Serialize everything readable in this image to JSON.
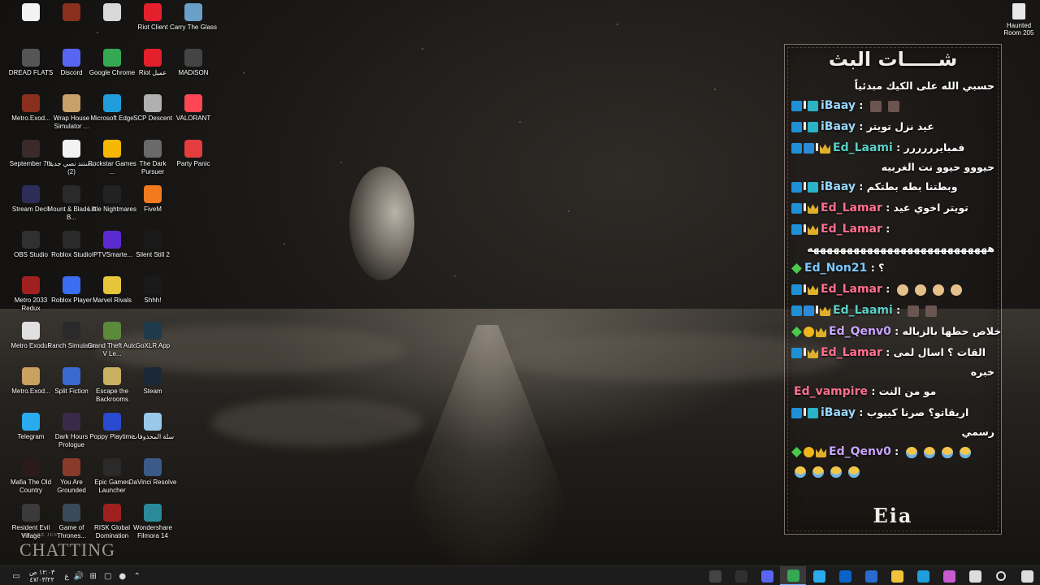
{
  "desktop": {
    "icons": [
      {
        "label": "",
        "color": "#f2f2f2"
      },
      {
        "label": "",
        "color": "#8a2f1e"
      },
      {
        "label": "",
        "color": "#d8d8d8"
      },
      {
        "label": "Riot Client",
        "color": "#e3202b"
      },
      {
        "label": "Carry The Glass",
        "color": "#6aa0c8"
      },
      {
        "label": "DREAD FLATS",
        "color": "#555555"
      },
      {
        "label": "Discord",
        "color": "#5865f2"
      },
      {
        "label": "Google Chrome",
        "color": "#34a853"
      },
      {
        "label": "Riot عميل",
        "color": "#e3202b"
      },
      {
        "label": "MADiSON",
        "color": "#444444"
      },
      {
        "label": "Metro.Exod...",
        "color": "#8a2f1e"
      },
      {
        "label": "Wrap House Simulator ...",
        "color": "#c9a06a"
      },
      {
        "label": "Microsoft Edge",
        "color": "#1f9edb"
      },
      {
        "label": "SCP Descent",
        "color": "#b0b0b0"
      },
      {
        "label": "VALORANT",
        "color": "#ff4655"
      },
      {
        "label": "September 7th",
        "color": "#3a2a2a"
      },
      {
        "label": "مستند نصي جديد (2)",
        "color": "#f2f2f2"
      },
      {
        "label": "Rockstar Games ...",
        "color": "#f5b800"
      },
      {
        "label": "The Dark Pursuer",
        "color": "#6a6a6a"
      },
      {
        "label": "Party Panic",
        "color": "#e33d3d"
      },
      {
        "label": "Stream Deck",
        "color": "#2d2d5a"
      },
      {
        "label": "Mount & Blade II B...",
        "color": "#2a2a2a"
      },
      {
        "label": "Little Nightmares",
        "color": "#222222"
      },
      {
        "label": "FiveM",
        "color": "#f47a20"
      },
      {
        "label": "",
        "color": "#000000"
      },
      {
        "label": "OBS Studio",
        "color": "#303030"
      },
      {
        "label": "Roblox Studio",
        "color": "#2a2a2a"
      },
      {
        "label": "IPTVSmarte...",
        "color": "#5a2ad0"
      },
      {
        "label": "Silent Still 2",
        "color": "#1a1a1a"
      },
      {
        "label": "",
        "color": "#000000"
      },
      {
        "label": "Metro 2033 Redux",
        "color": "#a02020"
      },
      {
        "label": "Roblox Player",
        "color": "#3a6df0"
      },
      {
        "label": "Marvel Rivals",
        "color": "#e6c53a"
      },
      {
        "label": "Shhh!",
        "color": "#1a1a1a"
      },
      {
        "label": "",
        "color": "#000000"
      },
      {
        "label": "Metro Exodus",
        "color": "#e0e0e0"
      },
      {
        "label": "Ranch Simulator",
        "color": "#2a2a2a"
      },
      {
        "label": "Grand Theft Auto V Le...",
        "color": "#5a8a3a"
      },
      {
        "label": "GoXLR App",
        "color": "#1f3a4a"
      },
      {
        "label": "",
        "color": "#000000"
      },
      {
        "label": "Metro.Exod...",
        "color": "#c8a060"
      },
      {
        "label": "Split Fiction",
        "color": "#3a6ad0"
      },
      {
        "label": "Escape the Backrooms",
        "color": "#c8b060"
      },
      {
        "label": "Steam",
        "color": "#1b2838"
      },
      {
        "label": "",
        "color": "#000000"
      },
      {
        "label": "Telegram",
        "color": "#2aabee"
      },
      {
        "label": "Dark Hours Prologue",
        "color": "#3a2a4a"
      },
      {
        "label": "Poppy Playtime",
        "color": "#2a4ad0"
      },
      {
        "label": "سلة المحذوفات",
        "color": "#9ac8e8"
      },
      {
        "label": "",
        "color": "#000000"
      },
      {
        "label": "Mafia The Old Country",
        "color": "#2a1a1a"
      },
      {
        "label": "You Are Grounded",
        "color": "#8a3a2a"
      },
      {
        "label": "Epic Games Launcher",
        "color": "#2a2a2a"
      },
      {
        "label": "DaVinci Resolve",
        "color": "#3a5a8a"
      },
      {
        "label": "",
        "color": "#000000"
      },
      {
        "label": "Resident Evil Village",
        "color": "#3a3a3a"
      },
      {
        "label": "Game of Thrones...",
        "color": "#3a4a5a"
      },
      {
        "label": "RISK Global Domination",
        "color": "#a02020"
      },
      {
        "label": "Wondershare Filmora 14",
        "color": "#2a8a9a"
      }
    ],
    "corner_icon_label": "Haunted Room 205"
  },
  "overlay": {
    "logo_text": "CHATTING",
    "logo_small": "WE ARE JUST"
  },
  "chat": {
    "title": "شـــــات البث",
    "pinned": "حسبي الله على الكيك مبدئياً",
    "messages": [
      {
        "user": "iBaay",
        "text": "",
        "badges": [
          "arrow",
          "sep",
          "cyan"
        ],
        "emoji": "pic",
        "user_class": "u-ibaay"
      },
      {
        "user": "iBaay",
        "text": "عيد نزل تويتر",
        "badges": [
          "arrow",
          "sep",
          "cyan"
        ],
        "user_class": "u-ibaay"
      },
      {
        "user": "Ed_Laami",
        "text": "فمبايرررررر",
        "badges": [
          "arrow",
          "cube",
          "sep",
          "crown"
        ],
        "user_class": "u-laami",
        "cont": "حيووو حيوو نت الغربيه"
      },
      {
        "user": "iBaay",
        "text": "وبطتنا بطه بطتكم",
        "badges": [
          "arrow",
          "sep",
          "cyan"
        ],
        "user_class": "u-ibaay"
      },
      {
        "user": "Ed_Lamar",
        "text": "تويتر اخوي عيد",
        "badges": [
          "arrow",
          "sep",
          "crown"
        ],
        "user_class": "u-lamar"
      },
      {
        "user": "Ed_Lamar",
        "text": "",
        "badges": [
          "arrow",
          "sep",
          "crown"
        ],
        "user_class": "u-lamar",
        "cont": "هههههههههههههههههههههههههههه"
      },
      {
        "user": "Ed_Non21",
        "text": "؟",
        "badges": [
          "gem"
        ],
        "user_class": "u-non"
      },
      {
        "user": "Ed_Lamar",
        "text": "",
        "badges": [
          "arrow",
          "sep",
          "crown"
        ],
        "user_class": "u-lamar",
        "emoji": "bread"
      },
      {
        "user": "Ed_Laami",
        "text": "",
        "badges": [
          "arrow",
          "cube",
          "sep",
          "crown"
        ],
        "user_class": "u-laami",
        "emoji": "pic"
      },
      {
        "user": "Ed_Qenv0",
        "text": "خلاص حطها بالزباله",
        "badges": [
          "gem",
          "one",
          "crown"
        ],
        "user_class": "u-qenv"
      },
      {
        "user": "Ed_Lamar",
        "text": "القات ؟ اسال لمى",
        "badges": [
          "arrow",
          "sep",
          "crown"
        ],
        "user_class": "u-lamar",
        "cont": "خبره"
      },
      {
        "user": "Ed_vampire",
        "text": "مو من النت",
        "badges": [],
        "user_class": "u-vamp"
      },
      {
        "user": "iBaay",
        "text": "اريقاتو؟ صرنا كيبوب",
        "badges": [
          "arrow",
          "sep",
          "cyan"
        ],
        "user_class": "u-ibaay",
        "cont": "رسمي"
      },
      {
        "user": "Ed_Qenv0",
        "text": "",
        "badges": [
          "gem",
          "one",
          "crown"
        ],
        "user_class": "u-qenv",
        "emoji": "cry"
      }
    ],
    "footer_logo": "Eia"
  },
  "taskbar": {
    "time": "١٢:٠٣ ص",
    "date": "٤٧/٠٣/٢٢",
    "language": "ع",
    "apps": [
      {
        "name": "capture-app-icon",
        "color": "#444444"
      },
      {
        "name": "obs-taskbar-icon",
        "color": "#303030"
      },
      {
        "name": "discord-taskbar-icon",
        "color": "#5865f2"
      },
      {
        "name": "chrome-taskbar-icon",
        "color": "#34a853"
      },
      {
        "name": "telegram-taskbar-icon",
        "color": "#2aabee"
      },
      {
        "name": "outlook-taskbar-icon",
        "color": "#0a64c8"
      },
      {
        "name": "store-taskbar-icon",
        "color": "#2a6ad0"
      },
      {
        "name": "explorer-taskbar-icon",
        "color": "#f2c23a"
      },
      {
        "name": "edge-taskbar-icon",
        "color": "#1f9edb"
      },
      {
        "name": "copilot-taskbar-icon",
        "color": "#c85ad0"
      },
      {
        "name": "task-view-icon",
        "color": "#dddddd"
      },
      {
        "name": "search-icon",
        "color": "#dddddd"
      },
      {
        "name": "start-icon",
        "color": "#dddddd"
      }
    ]
  }
}
